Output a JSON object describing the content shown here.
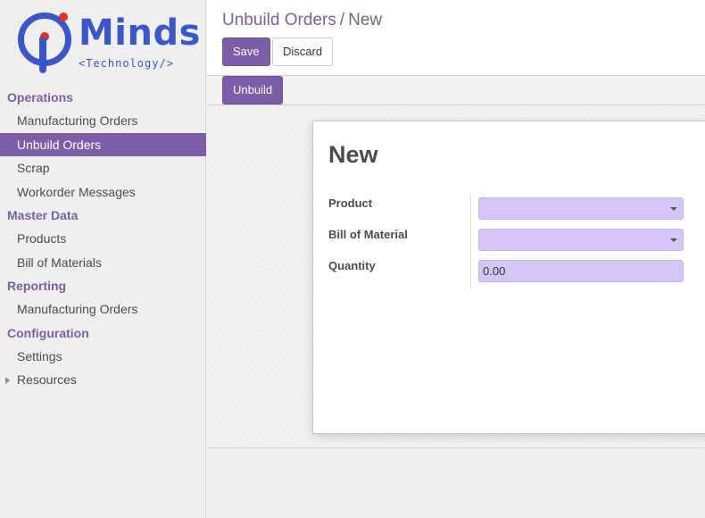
{
  "logo": {
    "word": "Minds",
    "subtitle": "<Technology/>",
    "colors": {
      "primary": "#3a56c8",
      "accent": "#e0312e"
    }
  },
  "sidebar": {
    "sections": [
      {
        "label": "Operations",
        "items": [
          "Manufacturing Orders",
          "Unbuild Orders",
          "Scrap",
          "Workorder Messages"
        ]
      },
      {
        "label": "Master Data",
        "items": [
          "Products",
          "Bill of Materials"
        ]
      },
      {
        "label": "Reporting",
        "items": [
          "Manufacturing Orders"
        ]
      },
      {
        "label": "Configuration",
        "items": [
          "Settings",
          "Resources"
        ]
      }
    ],
    "active_item": "Unbuild Orders"
  },
  "breadcrumb": {
    "parent": "Unbuild Orders",
    "separator": "/",
    "current": "New"
  },
  "toolbar": {
    "save_label": "Save",
    "discard_label": "Discard"
  },
  "statusbar": {
    "unbuild_label": "Unbuild"
  },
  "form": {
    "title": "New",
    "fields": {
      "product": {
        "label": "Product",
        "value": ""
      },
      "bom": {
        "label": "Bill of Material",
        "value": ""
      },
      "quantity": {
        "label": "Quantity",
        "value": "0.00"
      }
    }
  },
  "theme": {
    "accent": "#7c5ea8",
    "required_field": "#d6c5f7"
  }
}
